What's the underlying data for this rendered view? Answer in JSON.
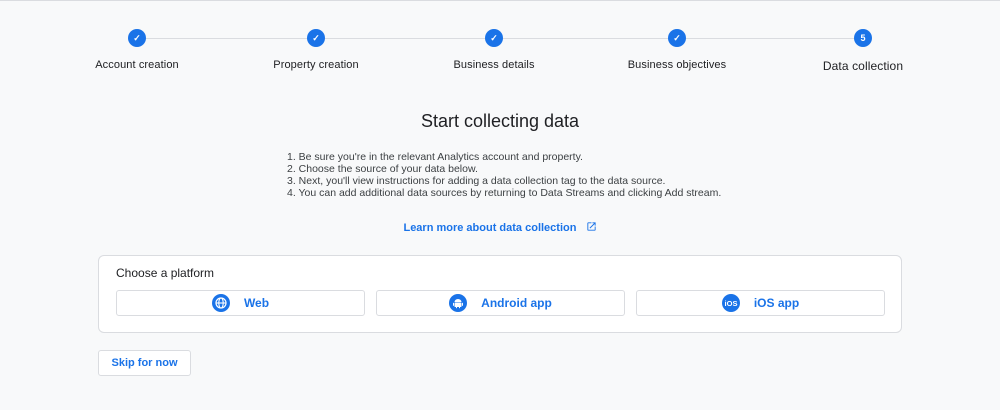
{
  "stepper": {
    "steps": [
      {
        "label": "Account creation",
        "state": "done",
        "marker": "✓"
      },
      {
        "label": "Property creation",
        "state": "done",
        "marker": "✓"
      },
      {
        "label": "Business details",
        "state": "done",
        "marker": "✓"
      },
      {
        "label": "Business objectives",
        "state": "done",
        "marker": "✓"
      },
      {
        "label": "Data collection",
        "state": "current",
        "marker": "5"
      }
    ]
  },
  "main": {
    "title": "Start collecting data",
    "instructions": [
      "1. Be sure you're in the relevant Analytics account and property.",
      "2. Choose the source of your data below.",
      "3. Next, you'll view instructions for adding a data collection tag to the data source.",
      "4. You can add additional data sources by returning to Data Streams and clicking Add stream."
    ],
    "learn_more": "Learn more about data collection"
  },
  "platform_card": {
    "title": "Choose a platform",
    "platforms": [
      {
        "label": "Web",
        "icon": "globe-icon"
      },
      {
        "label": "Android app",
        "icon": "android-icon"
      },
      {
        "label": "iOS app",
        "icon": "ios-icon"
      }
    ]
  },
  "footer": {
    "skip_label": "Skip for now"
  },
  "colors": {
    "accent": "#1a73e8",
    "background": "#f8f9fa",
    "border": "#dadce0"
  }
}
